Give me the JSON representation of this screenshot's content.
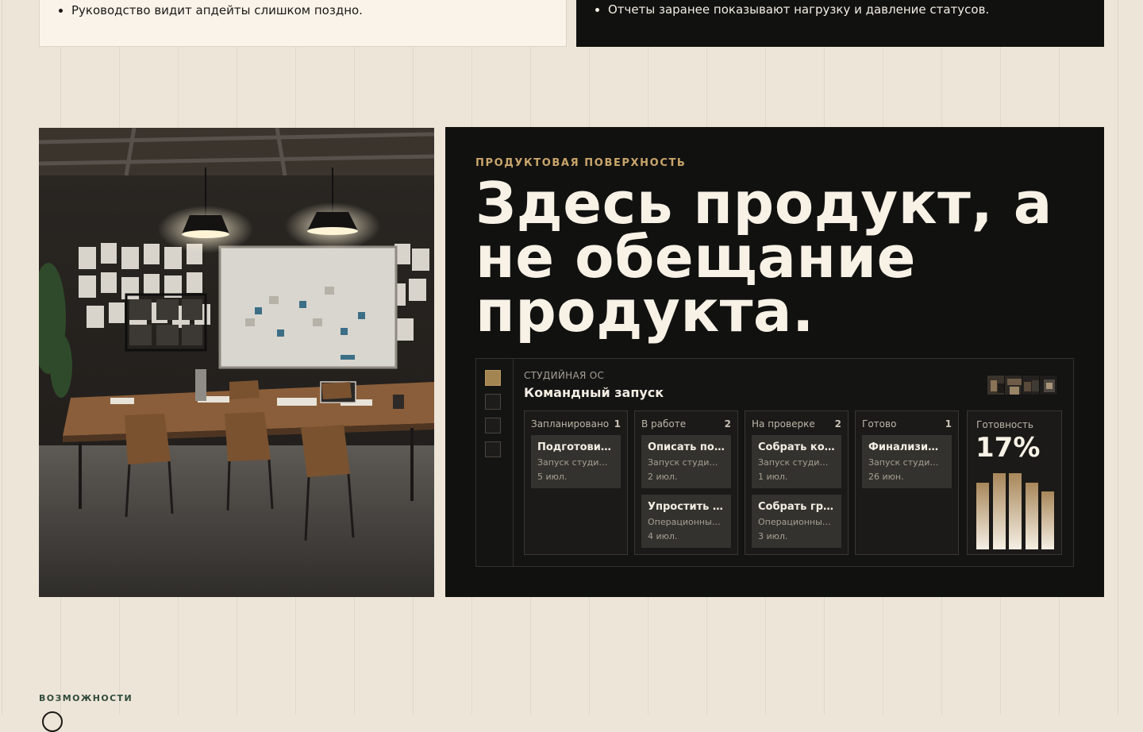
{
  "top_cards": {
    "left_item": "Руководство видит апдейты слишком поздно.",
    "right_item": "Отчеты заранее показывают нагрузку и давление статусов."
  },
  "product": {
    "eyebrow": "ПРОДУКТОВАЯ ПОВЕРХНОСТЬ",
    "headline": "Здесь продукт, а не обещание продукта."
  },
  "app": {
    "kicker": "СТУДИЙНАЯ ОС",
    "title": "Командный запуск",
    "columns": [
      {
        "label": "Запланировано",
        "count": "1",
        "cards": [
          {
            "title": "Подготовить…",
            "subtitle": "Запуск студи…",
            "date": "5 июл."
          }
        ]
      },
      {
        "label": "В работе",
        "count": "2",
        "cards": [
          {
            "title": "Описать по…",
            "subtitle": "Запуск студи…",
            "date": "2 июл."
          },
          {
            "title": "Упростить …",
            "subtitle": "Операционны…",
            "date": "4 июл."
          }
        ]
      },
      {
        "label": "На проверке",
        "count": "2",
        "cards": [
          {
            "title": "Собрать ко…",
            "subtitle": "Запуск студи…",
            "date": "1 июл."
          },
          {
            "title": "Собрать гр…",
            "subtitle": "Операционны…",
            "date": "3 июл."
          }
        ]
      },
      {
        "label": "Готово",
        "count": "1",
        "cards": [
          {
            "title": "Финализир…",
            "subtitle": "Запуск студи…",
            "date": "26 июн."
          }
        ]
      }
    ],
    "readiness": {
      "label": "Готовность",
      "value": "17%",
      "bars": [
        0.86,
        0.98,
        0.98,
        0.86,
        0.74
      ]
    }
  },
  "sections": {
    "features_label": "ВОЗМОЖНОСТИ"
  },
  "colors": {
    "accent": "#c9a66b",
    "panel_bg": "#111110",
    "page_bg": "#ede5d8",
    "section_label": "#2f4a3c"
  }
}
